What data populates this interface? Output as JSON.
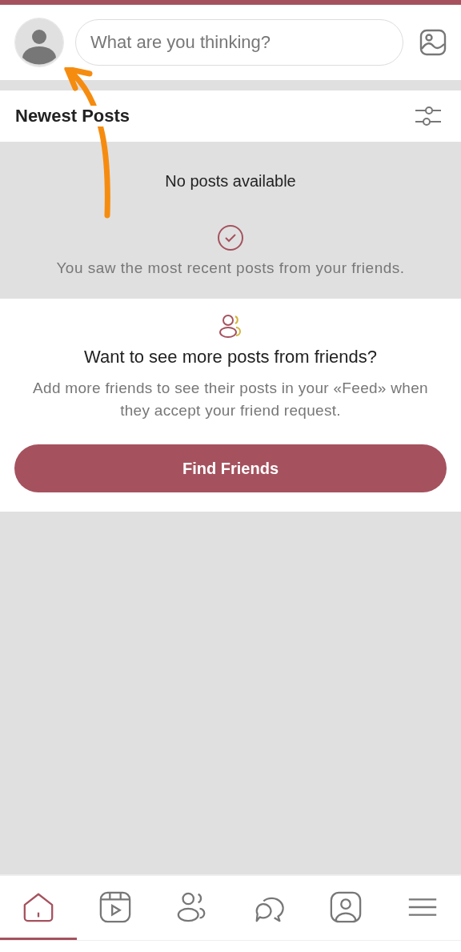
{
  "composer": {
    "placeholder": "What are you thinking?"
  },
  "feed_header": {
    "title": "Newest Posts"
  },
  "empty_state": {
    "message": "No posts available",
    "note": "You saw the most recent posts from your friends."
  },
  "suggestion": {
    "heading": "Want to see more posts from friends?",
    "body": "Add more friends to see their posts in your «Feed» when they accept your friend request.",
    "button": "Find Friends"
  },
  "nav_tabs": [
    {
      "kind": "home",
      "selected": true
    },
    {
      "kind": "video",
      "selected": false
    },
    {
      "kind": "friends",
      "selected": false
    },
    {
      "kind": "chat",
      "selected": false
    },
    {
      "kind": "profile",
      "selected": false
    },
    {
      "kind": "menu",
      "selected": false
    }
  ],
  "annotation": {
    "kind": "arrow"
  }
}
